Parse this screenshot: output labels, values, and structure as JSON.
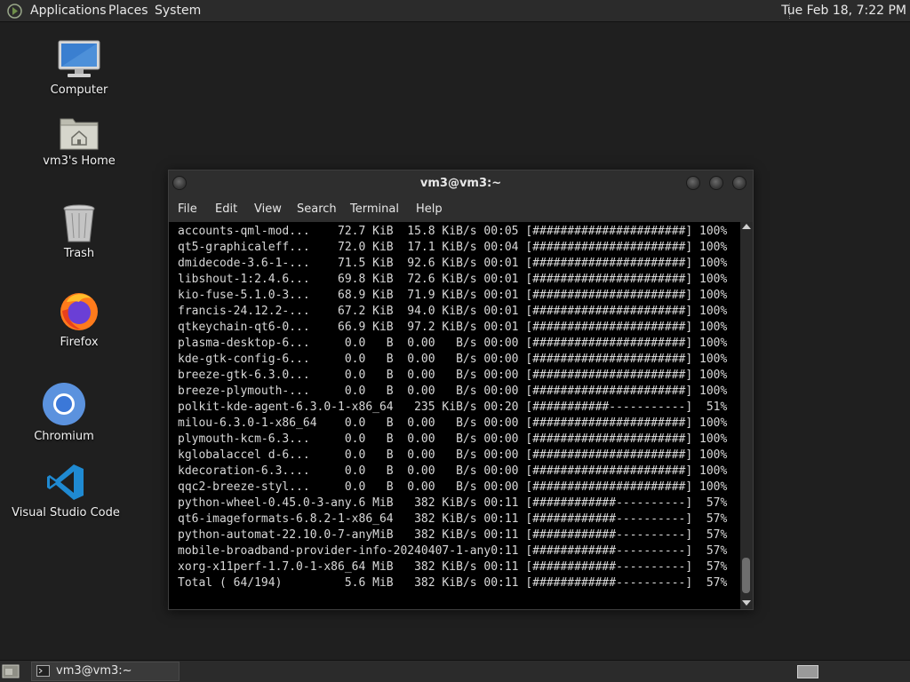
{
  "top_panel": {
    "menus": [
      "Applications",
      "Places",
      "System"
    ],
    "clock": "Tue Feb 18,  7:22 PM"
  },
  "desktop": {
    "icons": [
      {
        "label": "Computer",
        "icon": "computer-icon"
      },
      {
        "label": "vm3's Home",
        "icon": "home-folder-icon"
      },
      {
        "label": "Trash",
        "icon": "trash-icon"
      },
      {
        "label": "Firefox",
        "icon": "firefox-icon"
      },
      {
        "label": "Chromium",
        "icon": "chromium-icon"
      },
      {
        "label": "Visual Studio Code",
        "icon": "vscode-icon"
      }
    ]
  },
  "terminal": {
    "title": "vm3@vm3:~",
    "menu": [
      "File",
      "Edit",
      "View",
      "Search",
      "Terminal",
      "Help"
    ],
    "lines": [
      "accounts-qml-mod...    72.7 KiB  15.8 KiB/s 00:05 [######################] 100%",
      "qt5-graphicaleff...    72.0 KiB  17.1 KiB/s 00:04 [######################] 100%",
      "dmidecode-3.6-1-...    71.5 KiB  92.6 KiB/s 00:01 [######################] 100%",
      "libshout-1:2.4.6...    69.8 KiB  72.6 KiB/s 00:01 [######################] 100%",
      "kio-fuse-5.1.0-3...    68.9 KiB  71.9 KiB/s 00:01 [######################] 100%",
      "francis-24.12.2-...    67.2 KiB  94.0 KiB/s 00:01 [######################] 100%",
      "qtkeychain-qt6-0...    66.9 KiB  97.2 KiB/s 00:01 [######################] 100%",
      "plasma-desktop-6...     0.0   B  0.00   B/s 00:00 [######################] 100%",
      "kde-gtk-config-6...     0.0   B  0.00   B/s 00:00 [######################] 100%",
      "breeze-gtk-6.3.0...     0.0   B  0.00   B/s 00:00 [######################] 100%",
      "breeze-plymouth-...     0.0   B  0.00   B/s 00:00 [######################] 100%",
      "polkit-kde-agent-6.3.0-1-x86_64   235 KiB/s 00:20 [###########-----------]  51%",
      "milou-6.3.0-1-x86_64    0.0   B  0.00   B/s 00:00 [######################] 100%",
      "plymouth-kcm-6.3...     0.0   B  0.00   B/s 00:00 [######################] 100%",
      "kglobalaccel d-6...     0.0   B  0.00   B/s 00:00 [######################] 100%",
      "kdecoration-6.3....     0.0   B  0.00   B/s 00:00 [######################] 100%",
      "qqc2-breeze-styl...     0.0   B  0.00   B/s 00:00 [######################] 100%",
      "python-wheel-0.45.0-3-any.6 MiB   382 KiB/s 00:11 [############----------]  57%",
      "qt6-imageformats-6.8.2-1-x86_64   382 KiB/s 00:11 [############----------]  57%",
      "python-automat-22.10.0-7-anyMiB   382 KiB/s 00:11 [############----------]  57%",
      "mobile-broadband-provider-info-20240407-1-any0:11 [############----------]  57%",
      "xorg-x11perf-1.7.0-1-x86_64 MiB   382 KiB/s 00:11 [############----------]  57%",
      "Total ( 64/194)         5.6 MiB   382 KiB/s 00:11 [############----------]  57%"
    ]
  },
  "taskbar": {
    "task_label": "vm3@vm3:~"
  },
  "colors": {
    "desktop_bg": "#1f1f1f",
    "panel_bg": "#2b2b2b",
    "terminal_bg": "#000000"
  }
}
